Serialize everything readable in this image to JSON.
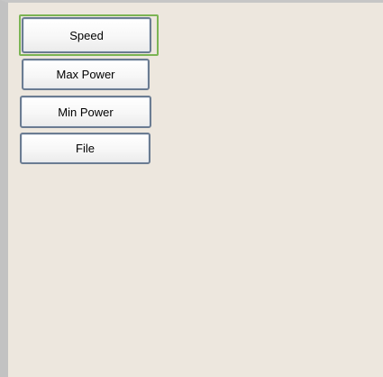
{
  "menu": {
    "items": [
      {
        "label": "Speed",
        "selected": true
      },
      {
        "label": "Max Power",
        "selected": false
      },
      {
        "label": "Min Power",
        "selected": false
      },
      {
        "label": "File",
        "selected": false
      }
    ]
  },
  "colors": {
    "background": "#ede7de",
    "button_border": "#6b7c92",
    "focus_frame": "#7bb453"
  }
}
